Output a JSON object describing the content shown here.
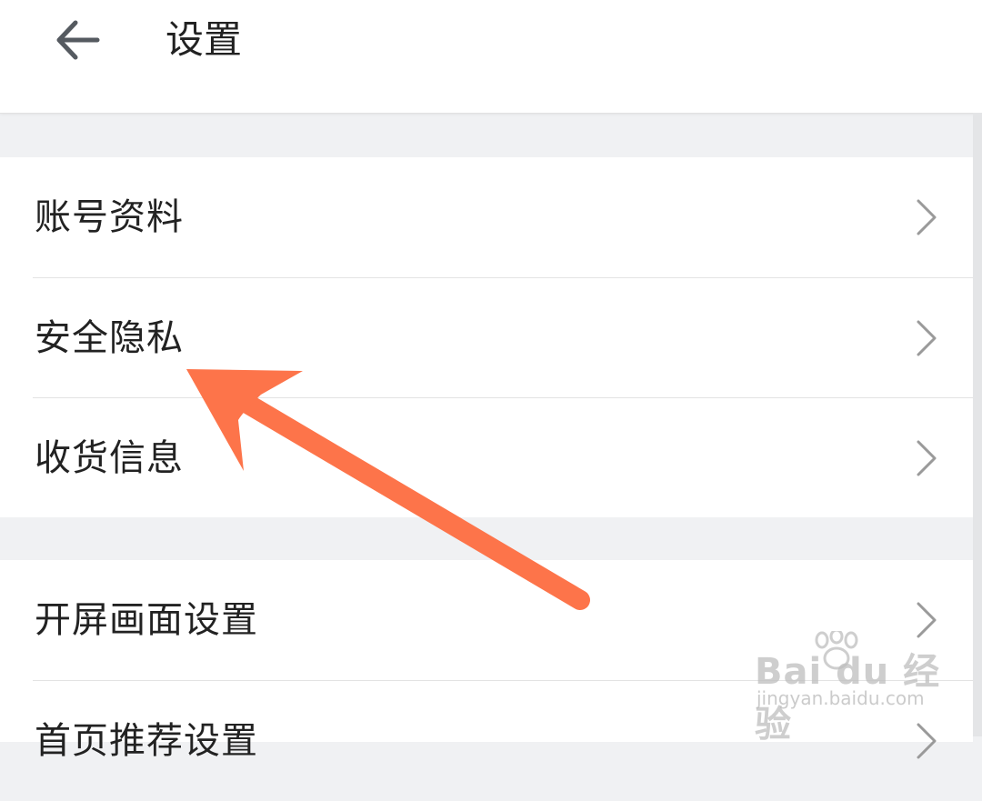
{
  "header": {
    "title": "设置",
    "back_icon": "arrow-left-icon"
  },
  "groups": [
    {
      "items": [
        {
          "label": "账号资料",
          "icon": "chevron-right-icon"
        },
        {
          "label": "安全隐私",
          "icon": "chevron-right-icon"
        },
        {
          "label": "收货信息",
          "icon": "chevron-right-icon"
        }
      ]
    },
    {
      "items": [
        {
          "label": "开屏画面设置",
          "icon": "chevron-right-icon"
        },
        {
          "label": "首页推荐设置",
          "icon": "chevron-right-icon"
        }
      ]
    }
  ],
  "annotation": {
    "arrow_color": "#fd744a",
    "points_to": "安全隐私"
  },
  "watermark": {
    "logo_text": "Bai du 经验",
    "url": "jingyan.baidu.com"
  },
  "colors": {
    "background": "#f0f1f3",
    "card": "#ffffff",
    "text": "#222222",
    "chevron": "#9a9a9a",
    "divider": "#e3e3e3"
  }
}
